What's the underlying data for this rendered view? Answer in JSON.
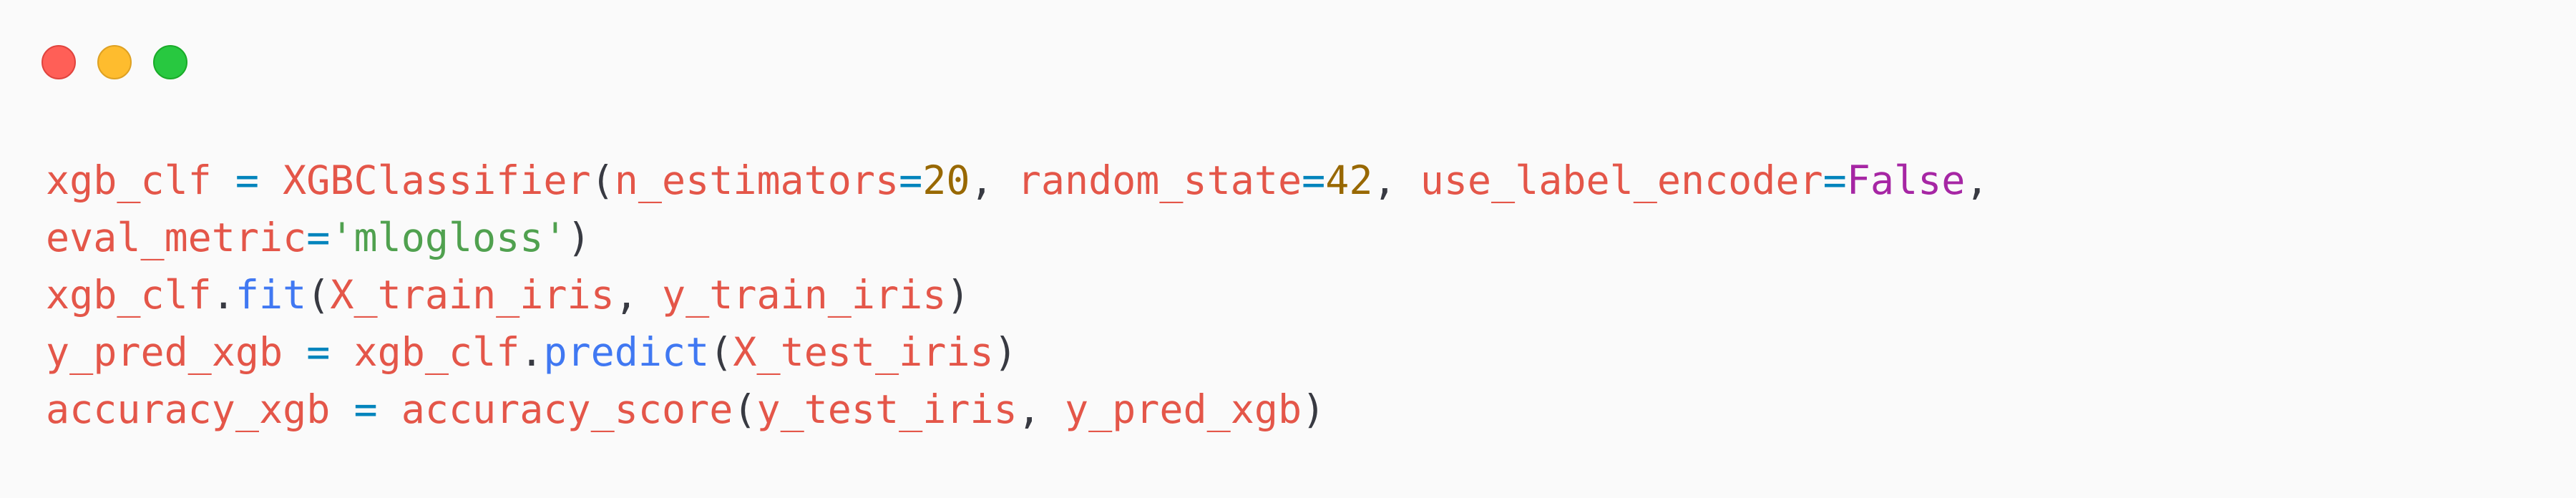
{
  "window": {
    "controls": [
      {
        "name": "close-button",
        "color": "#ff5f57"
      },
      {
        "name": "minimize-button",
        "color": "#febc2e"
      },
      {
        "name": "maximize-button",
        "color": "#28c840"
      }
    ]
  },
  "colors": {
    "background": "#fafafa",
    "variable": "#e45649",
    "operator": "#0184bc",
    "number": "#986801",
    "boolean": "#a626a4",
    "string": "#50a14f",
    "function": "#4078f2",
    "punctuation": "#383a42"
  },
  "code": {
    "lines": [
      [
        {
          "t": "xgb_clf",
          "k": "var"
        },
        {
          "t": " ",
          "k": "ws"
        },
        {
          "t": "=",
          "k": "op"
        },
        {
          "t": " ",
          "k": "ws"
        },
        {
          "t": "XGBClassifier",
          "k": "class"
        },
        {
          "t": "(",
          "k": "punc"
        },
        {
          "t": "n_estimators",
          "k": "param"
        },
        {
          "t": "=",
          "k": "op"
        },
        {
          "t": "20",
          "k": "num"
        },
        {
          "t": ",",
          "k": "punc"
        },
        {
          "t": " ",
          "k": "ws"
        },
        {
          "t": "random_state",
          "k": "param"
        },
        {
          "t": "=",
          "k": "op"
        },
        {
          "t": "42",
          "k": "num"
        },
        {
          "t": ",",
          "k": "punc"
        },
        {
          "t": " ",
          "k": "ws"
        },
        {
          "t": "use_label_encoder",
          "k": "param"
        },
        {
          "t": "=",
          "k": "op"
        },
        {
          "t": "False",
          "k": "bool"
        },
        {
          "t": ",",
          "k": "punc"
        }
      ],
      [
        {
          "t": "eval_metric",
          "k": "param"
        },
        {
          "t": "=",
          "k": "op"
        },
        {
          "t": "'mlogloss'",
          "k": "str"
        },
        {
          "t": ")",
          "k": "punc"
        }
      ],
      [
        {
          "t": "xgb_clf",
          "k": "var"
        },
        {
          "t": ".",
          "k": "punc"
        },
        {
          "t": "fit",
          "k": "fn"
        },
        {
          "t": "(",
          "k": "punc"
        },
        {
          "t": "X_train_iris",
          "k": "var"
        },
        {
          "t": ",",
          "k": "punc"
        },
        {
          "t": " ",
          "k": "ws"
        },
        {
          "t": "y_train_iris",
          "k": "var"
        },
        {
          "t": ")",
          "k": "punc"
        }
      ],
      [
        {
          "t": "y_pred_xgb",
          "k": "var"
        },
        {
          "t": " ",
          "k": "ws"
        },
        {
          "t": "=",
          "k": "op"
        },
        {
          "t": " ",
          "k": "ws"
        },
        {
          "t": "xgb_clf",
          "k": "var"
        },
        {
          "t": ".",
          "k": "punc"
        },
        {
          "t": "predict",
          "k": "fn"
        },
        {
          "t": "(",
          "k": "punc"
        },
        {
          "t": "X_test_iris",
          "k": "var"
        },
        {
          "t": ")",
          "k": "punc"
        }
      ],
      [
        {
          "t": "accuracy_xgb",
          "k": "var"
        },
        {
          "t": " ",
          "k": "ws"
        },
        {
          "t": "=",
          "k": "op"
        },
        {
          "t": " ",
          "k": "ws"
        },
        {
          "t": "accuracy_score",
          "k": "var"
        },
        {
          "t": "(",
          "k": "punc"
        },
        {
          "t": "y_test_iris",
          "k": "var"
        },
        {
          "t": ",",
          "k": "punc"
        },
        {
          "t": " ",
          "k": "ws"
        },
        {
          "t": "y_pred_xgb",
          "k": "var"
        },
        {
          "t": ")",
          "k": "punc"
        }
      ]
    ]
  }
}
